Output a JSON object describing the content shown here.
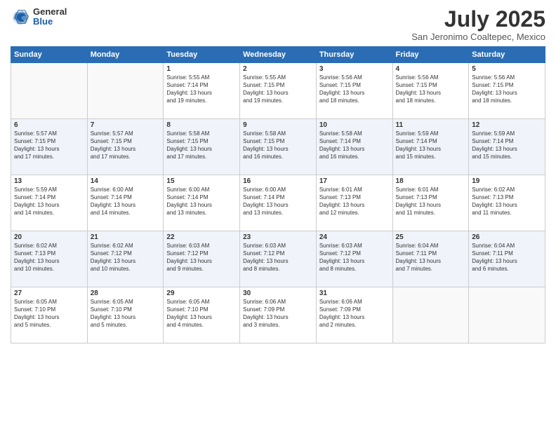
{
  "header": {
    "logo_general": "General",
    "logo_blue": "Blue",
    "month_title": "July 2025",
    "location": "San Jeronimo Coaltepec, Mexico"
  },
  "days_of_week": [
    "Sunday",
    "Monday",
    "Tuesday",
    "Wednesday",
    "Thursday",
    "Friday",
    "Saturday"
  ],
  "weeks": [
    [
      {
        "day": "",
        "info": ""
      },
      {
        "day": "",
        "info": ""
      },
      {
        "day": "1",
        "info": "Sunrise: 5:55 AM\nSunset: 7:14 PM\nDaylight: 13 hours\nand 19 minutes."
      },
      {
        "day": "2",
        "info": "Sunrise: 5:55 AM\nSunset: 7:15 PM\nDaylight: 13 hours\nand 19 minutes."
      },
      {
        "day": "3",
        "info": "Sunrise: 5:56 AM\nSunset: 7:15 PM\nDaylight: 13 hours\nand 18 minutes."
      },
      {
        "day": "4",
        "info": "Sunrise: 5:56 AM\nSunset: 7:15 PM\nDaylight: 13 hours\nand 18 minutes."
      },
      {
        "day": "5",
        "info": "Sunrise: 5:56 AM\nSunset: 7:15 PM\nDaylight: 13 hours\nand 18 minutes."
      }
    ],
    [
      {
        "day": "6",
        "info": "Sunrise: 5:57 AM\nSunset: 7:15 PM\nDaylight: 13 hours\nand 17 minutes."
      },
      {
        "day": "7",
        "info": "Sunrise: 5:57 AM\nSunset: 7:15 PM\nDaylight: 13 hours\nand 17 minutes."
      },
      {
        "day": "8",
        "info": "Sunrise: 5:58 AM\nSunset: 7:15 PM\nDaylight: 13 hours\nand 17 minutes."
      },
      {
        "day": "9",
        "info": "Sunrise: 5:58 AM\nSunset: 7:15 PM\nDaylight: 13 hours\nand 16 minutes."
      },
      {
        "day": "10",
        "info": "Sunrise: 5:58 AM\nSunset: 7:14 PM\nDaylight: 13 hours\nand 16 minutes."
      },
      {
        "day": "11",
        "info": "Sunrise: 5:59 AM\nSunset: 7:14 PM\nDaylight: 13 hours\nand 15 minutes."
      },
      {
        "day": "12",
        "info": "Sunrise: 5:59 AM\nSunset: 7:14 PM\nDaylight: 13 hours\nand 15 minutes."
      }
    ],
    [
      {
        "day": "13",
        "info": "Sunrise: 5:59 AM\nSunset: 7:14 PM\nDaylight: 13 hours\nand 14 minutes."
      },
      {
        "day": "14",
        "info": "Sunrise: 6:00 AM\nSunset: 7:14 PM\nDaylight: 13 hours\nand 14 minutes."
      },
      {
        "day": "15",
        "info": "Sunrise: 6:00 AM\nSunset: 7:14 PM\nDaylight: 13 hours\nand 13 minutes."
      },
      {
        "day": "16",
        "info": "Sunrise: 6:00 AM\nSunset: 7:14 PM\nDaylight: 13 hours\nand 13 minutes."
      },
      {
        "day": "17",
        "info": "Sunrise: 6:01 AM\nSunset: 7:13 PM\nDaylight: 13 hours\nand 12 minutes."
      },
      {
        "day": "18",
        "info": "Sunrise: 6:01 AM\nSunset: 7:13 PM\nDaylight: 13 hours\nand 11 minutes."
      },
      {
        "day": "19",
        "info": "Sunrise: 6:02 AM\nSunset: 7:13 PM\nDaylight: 13 hours\nand 11 minutes."
      }
    ],
    [
      {
        "day": "20",
        "info": "Sunrise: 6:02 AM\nSunset: 7:13 PM\nDaylight: 13 hours\nand 10 minutes."
      },
      {
        "day": "21",
        "info": "Sunrise: 6:02 AM\nSunset: 7:12 PM\nDaylight: 13 hours\nand 10 minutes."
      },
      {
        "day": "22",
        "info": "Sunrise: 6:03 AM\nSunset: 7:12 PM\nDaylight: 13 hours\nand 9 minutes."
      },
      {
        "day": "23",
        "info": "Sunrise: 6:03 AM\nSunset: 7:12 PM\nDaylight: 13 hours\nand 8 minutes."
      },
      {
        "day": "24",
        "info": "Sunrise: 6:03 AM\nSunset: 7:12 PM\nDaylight: 13 hours\nand 8 minutes."
      },
      {
        "day": "25",
        "info": "Sunrise: 6:04 AM\nSunset: 7:11 PM\nDaylight: 13 hours\nand 7 minutes."
      },
      {
        "day": "26",
        "info": "Sunrise: 6:04 AM\nSunset: 7:11 PM\nDaylight: 13 hours\nand 6 minutes."
      }
    ],
    [
      {
        "day": "27",
        "info": "Sunrise: 6:05 AM\nSunset: 7:10 PM\nDaylight: 13 hours\nand 5 minutes."
      },
      {
        "day": "28",
        "info": "Sunrise: 6:05 AM\nSunset: 7:10 PM\nDaylight: 13 hours\nand 5 minutes."
      },
      {
        "day": "29",
        "info": "Sunrise: 6:05 AM\nSunset: 7:10 PM\nDaylight: 13 hours\nand 4 minutes."
      },
      {
        "day": "30",
        "info": "Sunrise: 6:06 AM\nSunset: 7:09 PM\nDaylight: 13 hours\nand 3 minutes."
      },
      {
        "day": "31",
        "info": "Sunrise: 6:06 AM\nSunset: 7:09 PM\nDaylight: 13 hours\nand 2 minutes."
      },
      {
        "day": "",
        "info": ""
      },
      {
        "day": "",
        "info": ""
      }
    ]
  ]
}
